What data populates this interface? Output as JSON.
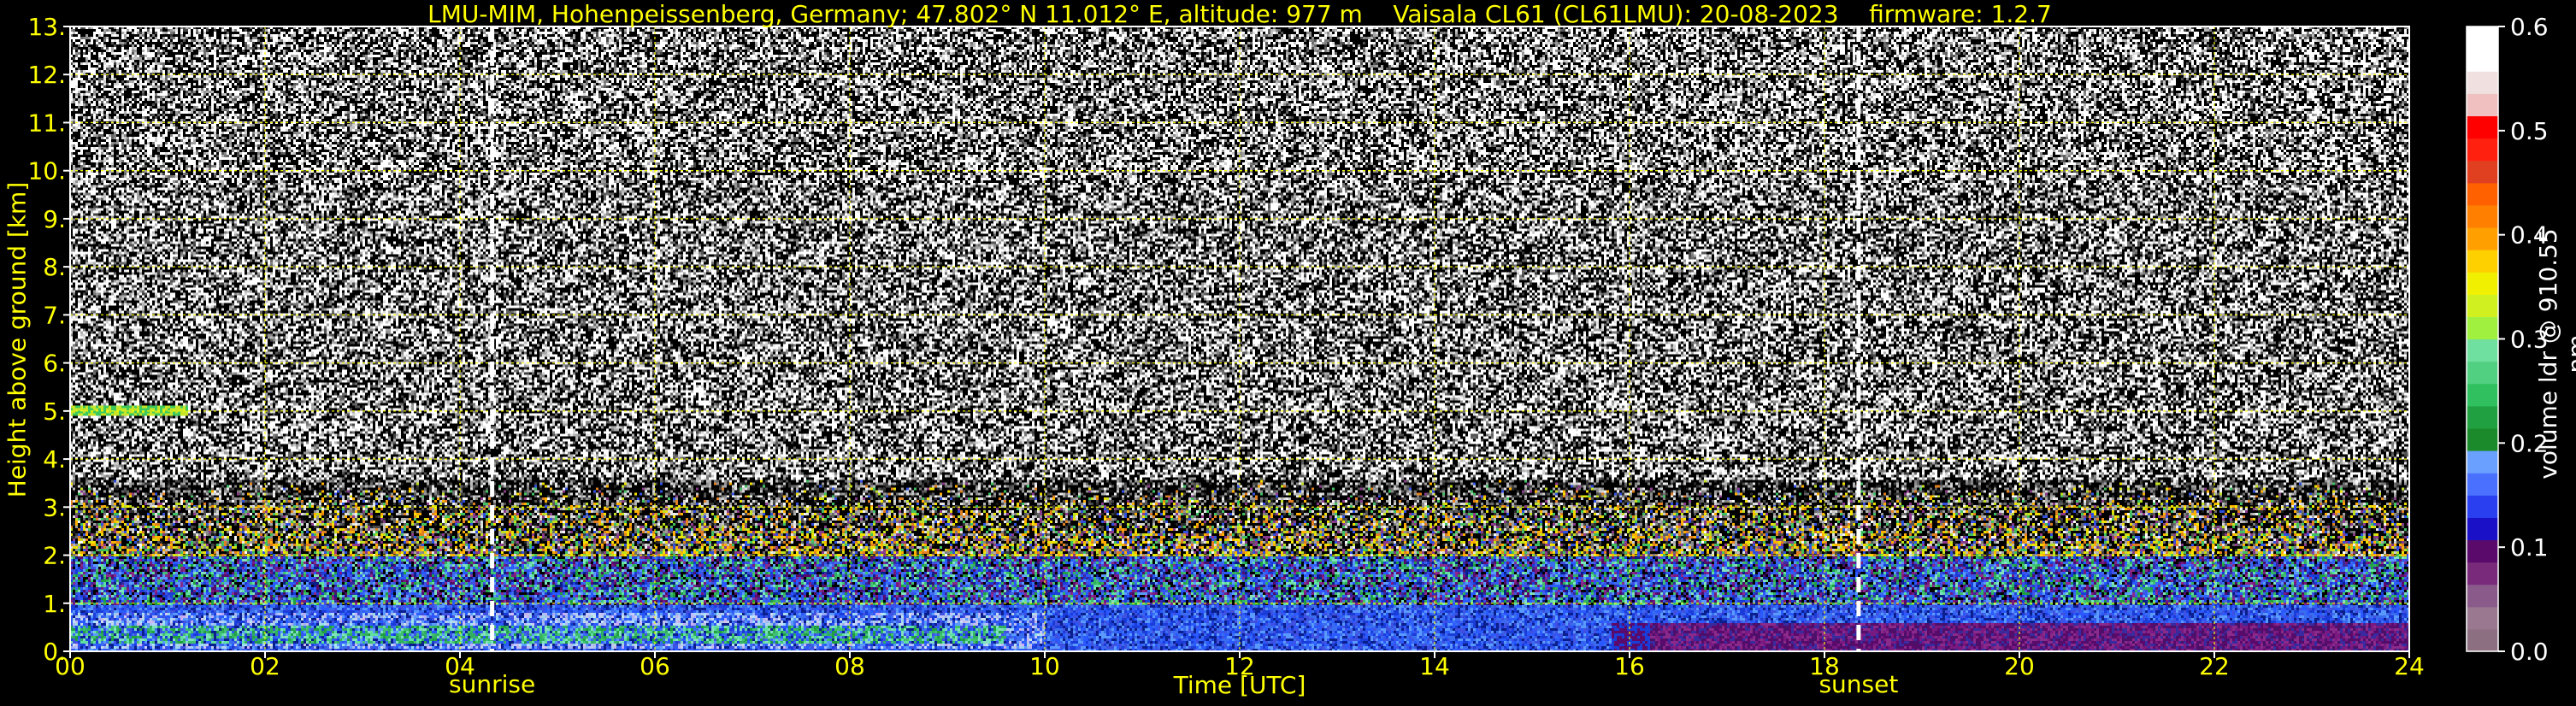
{
  "header": {
    "title": "LMU-MIM, Hohenpeissenberg, Germany; 47.802° N 11.012° E, altitude: 977 m    Vaisala CL61 (CL61LMU): 20-08-2023    firmware: 1.2.7"
  },
  "chart_data": {
    "type": "heatmap",
    "title": "LMU-MIM, Hohenpeissenberg, Germany; 47.802° N 11.012° E, altitude: 977 m    Vaisala CL61 (CL61LMU): 20-08-2023    firmware: 1.2.7",
    "xlabel": "Time [UTC]",
    "ylabel": "Height above ground [km]",
    "colorbar_label": "volume ldr @ 910.55 nm",
    "xlim": [
      0,
      24
    ],
    "ylim": [
      0,
      13
    ],
    "clim": [
      0,
      0.6
    ],
    "x_ticks": [
      0,
      2,
      4,
      6,
      8,
      10,
      12,
      14,
      16,
      18,
      20,
      22,
      24
    ],
    "x_tick_labels": [
      "00",
      "02",
      "04",
      "06",
      "08",
      "10",
      "12",
      "14",
      "16",
      "18",
      "20",
      "22",
      "24"
    ],
    "y_ticks": [
      0,
      1,
      2,
      3,
      4,
      5,
      6,
      7,
      8,
      9,
      10,
      11,
      12,
      13
    ],
    "y_tick_labels": [
      "0.",
      "1.",
      "2.",
      "3.",
      "4.",
      "5.",
      "6.",
      "7.",
      "8.",
      "9.",
      "10.",
      "11.",
      "12.",
      "13."
    ],
    "colorbar_ticks": [
      0.0,
      0.1,
      0.2,
      0.3,
      0.4,
      0.5,
      0.6
    ],
    "colorbar_tick_labels": [
      "0.0",
      "0.1",
      "0.2",
      "0.3",
      "0.4",
      "0.5",
      "0.6"
    ],
    "colorbar_colors": [
      "#8c6f80",
      "#9a7890",
      "#8a5a8a",
      "#7a2a7a",
      "#5a0a6a",
      "#1a10c8",
      "#2a40f0",
      "#4a70ff",
      "#6aa0ff",
      "#1a8a2a",
      "#20a040",
      "#30c060",
      "#50d080",
      "#70e0a0",
      "#a0f040",
      "#d0f020",
      "#f0f000",
      "#ffd000",
      "#ffa000",
      "#ff8000",
      "#ff6000",
      "#e04020",
      "#ff2010",
      "#ff0000",
      "#f0c0c0",
      "#f0e0e0",
      "#ffffff",
      "#ffffff"
    ],
    "grid": true,
    "grid_color": "#ffff00",
    "annotations": [
      {
        "label": "sunrise",
        "x": 4.33
      },
      {
        "label": "sunset",
        "x": 18.35
      }
    ],
    "layers": [
      {
        "name": "noise",
        "y_range": [
          3.5,
          13
        ],
        "appearance": "random black/white/grey speckle"
      },
      {
        "name": "residual layer",
        "y_range": [
          2.0,
          3.5
        ],
        "x_range": [
          0,
          24
        ],
        "appearance": "sparse green/yellow/orange"
      },
      {
        "name": "aerosol layer",
        "y_range": [
          1.0,
          2.0
        ],
        "x_range": [
          0,
          24
        ],
        "appearance": "blue/green/purple speckle"
      },
      {
        "name": "boundary layer",
        "y_range": [
          0,
          1.0
        ],
        "x_range": [
          0,
          24
        ],
        "appearance": "light blue and green, purple after 16 UTC"
      },
      {
        "name": "thin layer",
        "y_range": [
          4.95,
          5.15
        ],
        "x_range": [
          0,
          1.2
        ],
        "appearance": "green/yellow line"
      }
    ]
  }
}
